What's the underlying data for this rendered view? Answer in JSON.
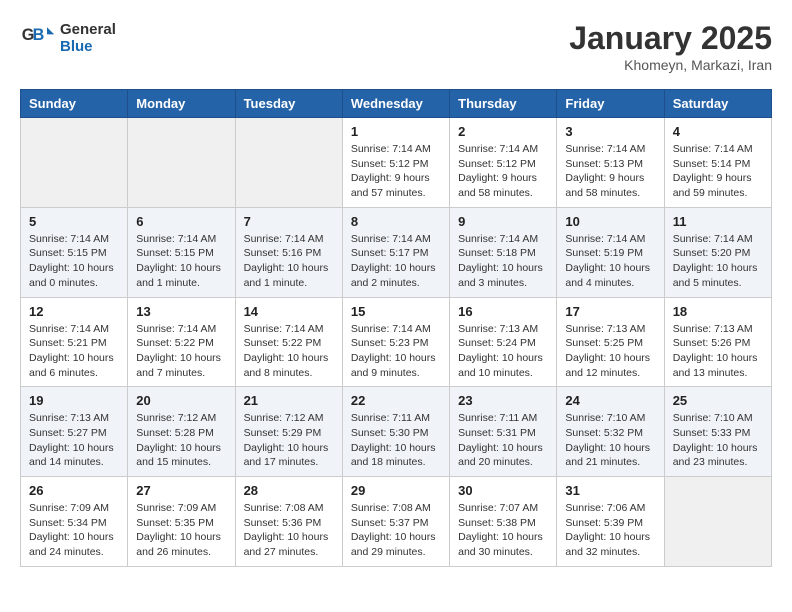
{
  "logo": {
    "line1": "General",
    "line2": "Blue"
  },
  "title": "January 2025",
  "location": "Khomeyn, Markazi, Iran",
  "weekdays": [
    "Sunday",
    "Monday",
    "Tuesday",
    "Wednesday",
    "Thursday",
    "Friday",
    "Saturday"
  ],
  "weeks": [
    [
      null,
      null,
      null,
      {
        "day": "1",
        "sunrise": "Sunrise: 7:14 AM",
        "sunset": "Sunset: 5:12 PM",
        "daylight": "Daylight: 9 hours and 57 minutes."
      },
      {
        "day": "2",
        "sunrise": "Sunrise: 7:14 AM",
        "sunset": "Sunset: 5:12 PM",
        "daylight": "Daylight: 9 hours and 58 minutes."
      },
      {
        "day": "3",
        "sunrise": "Sunrise: 7:14 AM",
        "sunset": "Sunset: 5:13 PM",
        "daylight": "Daylight: 9 hours and 58 minutes."
      },
      {
        "day": "4",
        "sunrise": "Sunrise: 7:14 AM",
        "sunset": "Sunset: 5:14 PM",
        "daylight": "Daylight: 9 hours and 59 minutes."
      }
    ],
    [
      {
        "day": "5",
        "sunrise": "Sunrise: 7:14 AM",
        "sunset": "Sunset: 5:15 PM",
        "daylight": "Daylight: 10 hours and 0 minutes."
      },
      {
        "day": "6",
        "sunrise": "Sunrise: 7:14 AM",
        "sunset": "Sunset: 5:15 PM",
        "daylight": "Daylight: 10 hours and 1 minute."
      },
      {
        "day": "7",
        "sunrise": "Sunrise: 7:14 AM",
        "sunset": "Sunset: 5:16 PM",
        "daylight": "Daylight: 10 hours and 1 minute."
      },
      {
        "day": "8",
        "sunrise": "Sunrise: 7:14 AM",
        "sunset": "Sunset: 5:17 PM",
        "daylight": "Daylight: 10 hours and 2 minutes."
      },
      {
        "day": "9",
        "sunrise": "Sunrise: 7:14 AM",
        "sunset": "Sunset: 5:18 PM",
        "daylight": "Daylight: 10 hours and 3 minutes."
      },
      {
        "day": "10",
        "sunrise": "Sunrise: 7:14 AM",
        "sunset": "Sunset: 5:19 PM",
        "daylight": "Daylight: 10 hours and 4 minutes."
      },
      {
        "day": "11",
        "sunrise": "Sunrise: 7:14 AM",
        "sunset": "Sunset: 5:20 PM",
        "daylight": "Daylight: 10 hours and 5 minutes."
      }
    ],
    [
      {
        "day": "12",
        "sunrise": "Sunrise: 7:14 AM",
        "sunset": "Sunset: 5:21 PM",
        "daylight": "Daylight: 10 hours and 6 minutes."
      },
      {
        "day": "13",
        "sunrise": "Sunrise: 7:14 AM",
        "sunset": "Sunset: 5:22 PM",
        "daylight": "Daylight: 10 hours and 7 minutes."
      },
      {
        "day": "14",
        "sunrise": "Sunrise: 7:14 AM",
        "sunset": "Sunset: 5:22 PM",
        "daylight": "Daylight: 10 hours and 8 minutes."
      },
      {
        "day": "15",
        "sunrise": "Sunrise: 7:14 AM",
        "sunset": "Sunset: 5:23 PM",
        "daylight": "Daylight: 10 hours and 9 minutes."
      },
      {
        "day": "16",
        "sunrise": "Sunrise: 7:13 AM",
        "sunset": "Sunset: 5:24 PM",
        "daylight": "Daylight: 10 hours and 10 minutes."
      },
      {
        "day": "17",
        "sunrise": "Sunrise: 7:13 AM",
        "sunset": "Sunset: 5:25 PM",
        "daylight": "Daylight: 10 hours and 12 minutes."
      },
      {
        "day": "18",
        "sunrise": "Sunrise: 7:13 AM",
        "sunset": "Sunset: 5:26 PM",
        "daylight": "Daylight: 10 hours and 13 minutes."
      }
    ],
    [
      {
        "day": "19",
        "sunrise": "Sunrise: 7:13 AM",
        "sunset": "Sunset: 5:27 PM",
        "daylight": "Daylight: 10 hours and 14 minutes."
      },
      {
        "day": "20",
        "sunrise": "Sunrise: 7:12 AM",
        "sunset": "Sunset: 5:28 PM",
        "daylight": "Daylight: 10 hours and 15 minutes."
      },
      {
        "day": "21",
        "sunrise": "Sunrise: 7:12 AM",
        "sunset": "Sunset: 5:29 PM",
        "daylight": "Daylight: 10 hours and 17 minutes."
      },
      {
        "day": "22",
        "sunrise": "Sunrise: 7:11 AM",
        "sunset": "Sunset: 5:30 PM",
        "daylight": "Daylight: 10 hours and 18 minutes."
      },
      {
        "day": "23",
        "sunrise": "Sunrise: 7:11 AM",
        "sunset": "Sunset: 5:31 PM",
        "daylight": "Daylight: 10 hours and 20 minutes."
      },
      {
        "day": "24",
        "sunrise": "Sunrise: 7:10 AM",
        "sunset": "Sunset: 5:32 PM",
        "daylight": "Daylight: 10 hours and 21 minutes."
      },
      {
        "day": "25",
        "sunrise": "Sunrise: 7:10 AM",
        "sunset": "Sunset: 5:33 PM",
        "daylight": "Daylight: 10 hours and 23 minutes."
      }
    ],
    [
      {
        "day": "26",
        "sunrise": "Sunrise: 7:09 AM",
        "sunset": "Sunset: 5:34 PM",
        "daylight": "Daylight: 10 hours and 24 minutes."
      },
      {
        "day": "27",
        "sunrise": "Sunrise: 7:09 AM",
        "sunset": "Sunset: 5:35 PM",
        "daylight": "Daylight: 10 hours and 26 minutes."
      },
      {
        "day": "28",
        "sunrise": "Sunrise: 7:08 AM",
        "sunset": "Sunset: 5:36 PM",
        "daylight": "Daylight: 10 hours and 27 minutes."
      },
      {
        "day": "29",
        "sunrise": "Sunrise: 7:08 AM",
        "sunset": "Sunset: 5:37 PM",
        "daylight": "Daylight: 10 hours and 29 minutes."
      },
      {
        "day": "30",
        "sunrise": "Sunrise: 7:07 AM",
        "sunset": "Sunset: 5:38 PM",
        "daylight": "Daylight: 10 hours and 30 minutes."
      },
      {
        "day": "31",
        "sunrise": "Sunrise: 7:06 AM",
        "sunset": "Sunset: 5:39 PM",
        "daylight": "Daylight: 10 hours and 32 minutes."
      },
      null
    ]
  ]
}
